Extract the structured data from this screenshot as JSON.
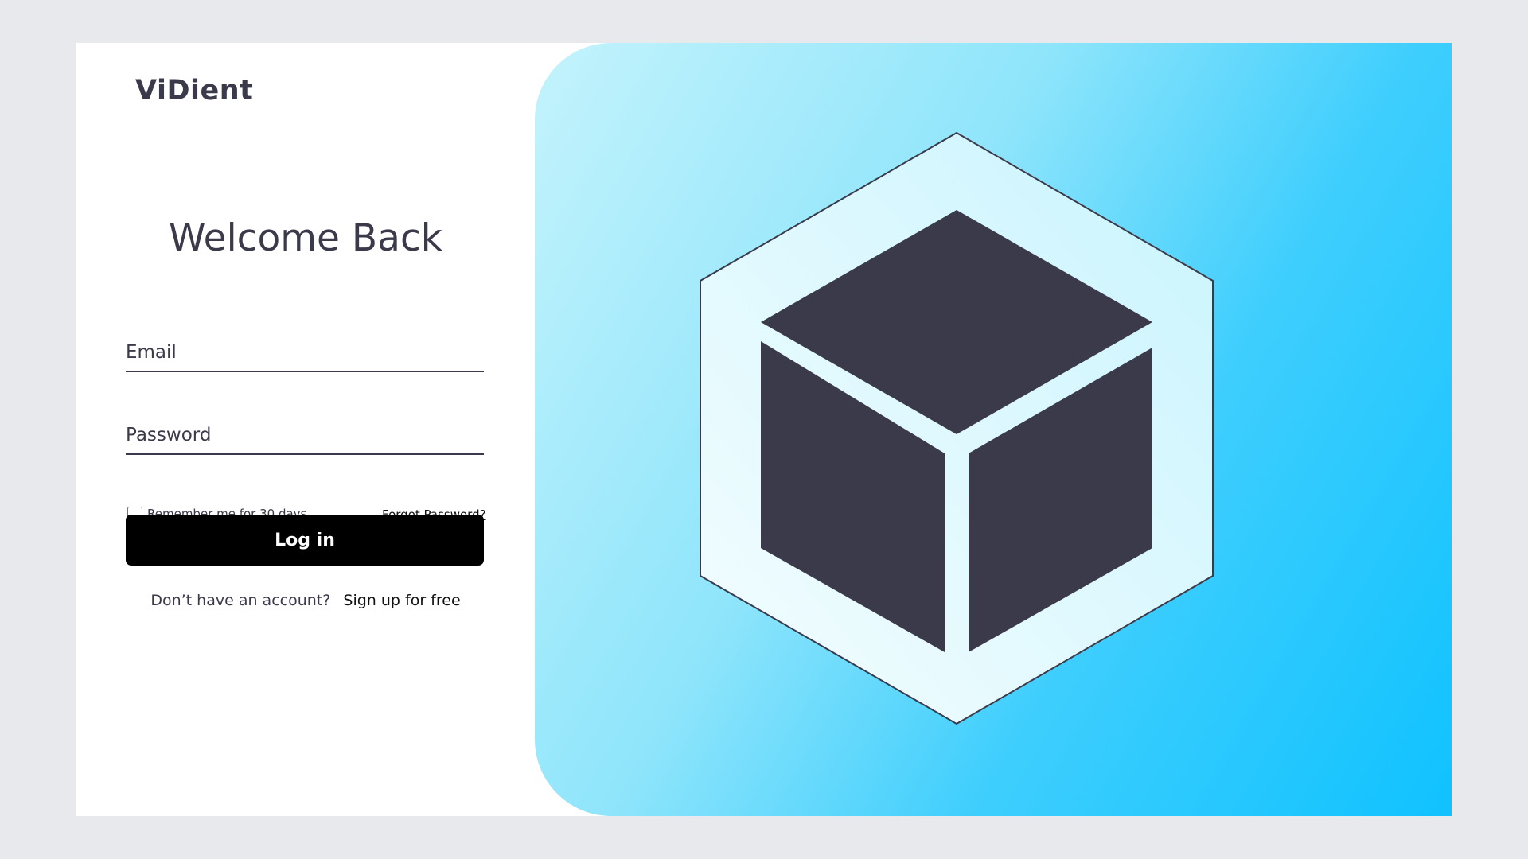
{
  "brand": {
    "name": "ViDient"
  },
  "login": {
    "heading": "Welcome Back",
    "email_placeholder": "Email",
    "password_placeholder": "Password",
    "remember_label": "Remember me for 30 days",
    "remember_checked": false,
    "forgot_label": "Forgot Password?",
    "submit_label": "Log in",
    "signup_prompt": "Don’t have an account?",
    "signup_link": "Sign up for free"
  },
  "hero": {
    "icon": "cube-in-hexagon-icon",
    "gradient_start": "#c4f3fc",
    "gradient_end": "#10c2ff",
    "cube_color": "#3b3a4a"
  },
  "colors": {
    "page_background": "#e8e9ec",
    "text": "#3b3a4a",
    "button": "#000000"
  }
}
